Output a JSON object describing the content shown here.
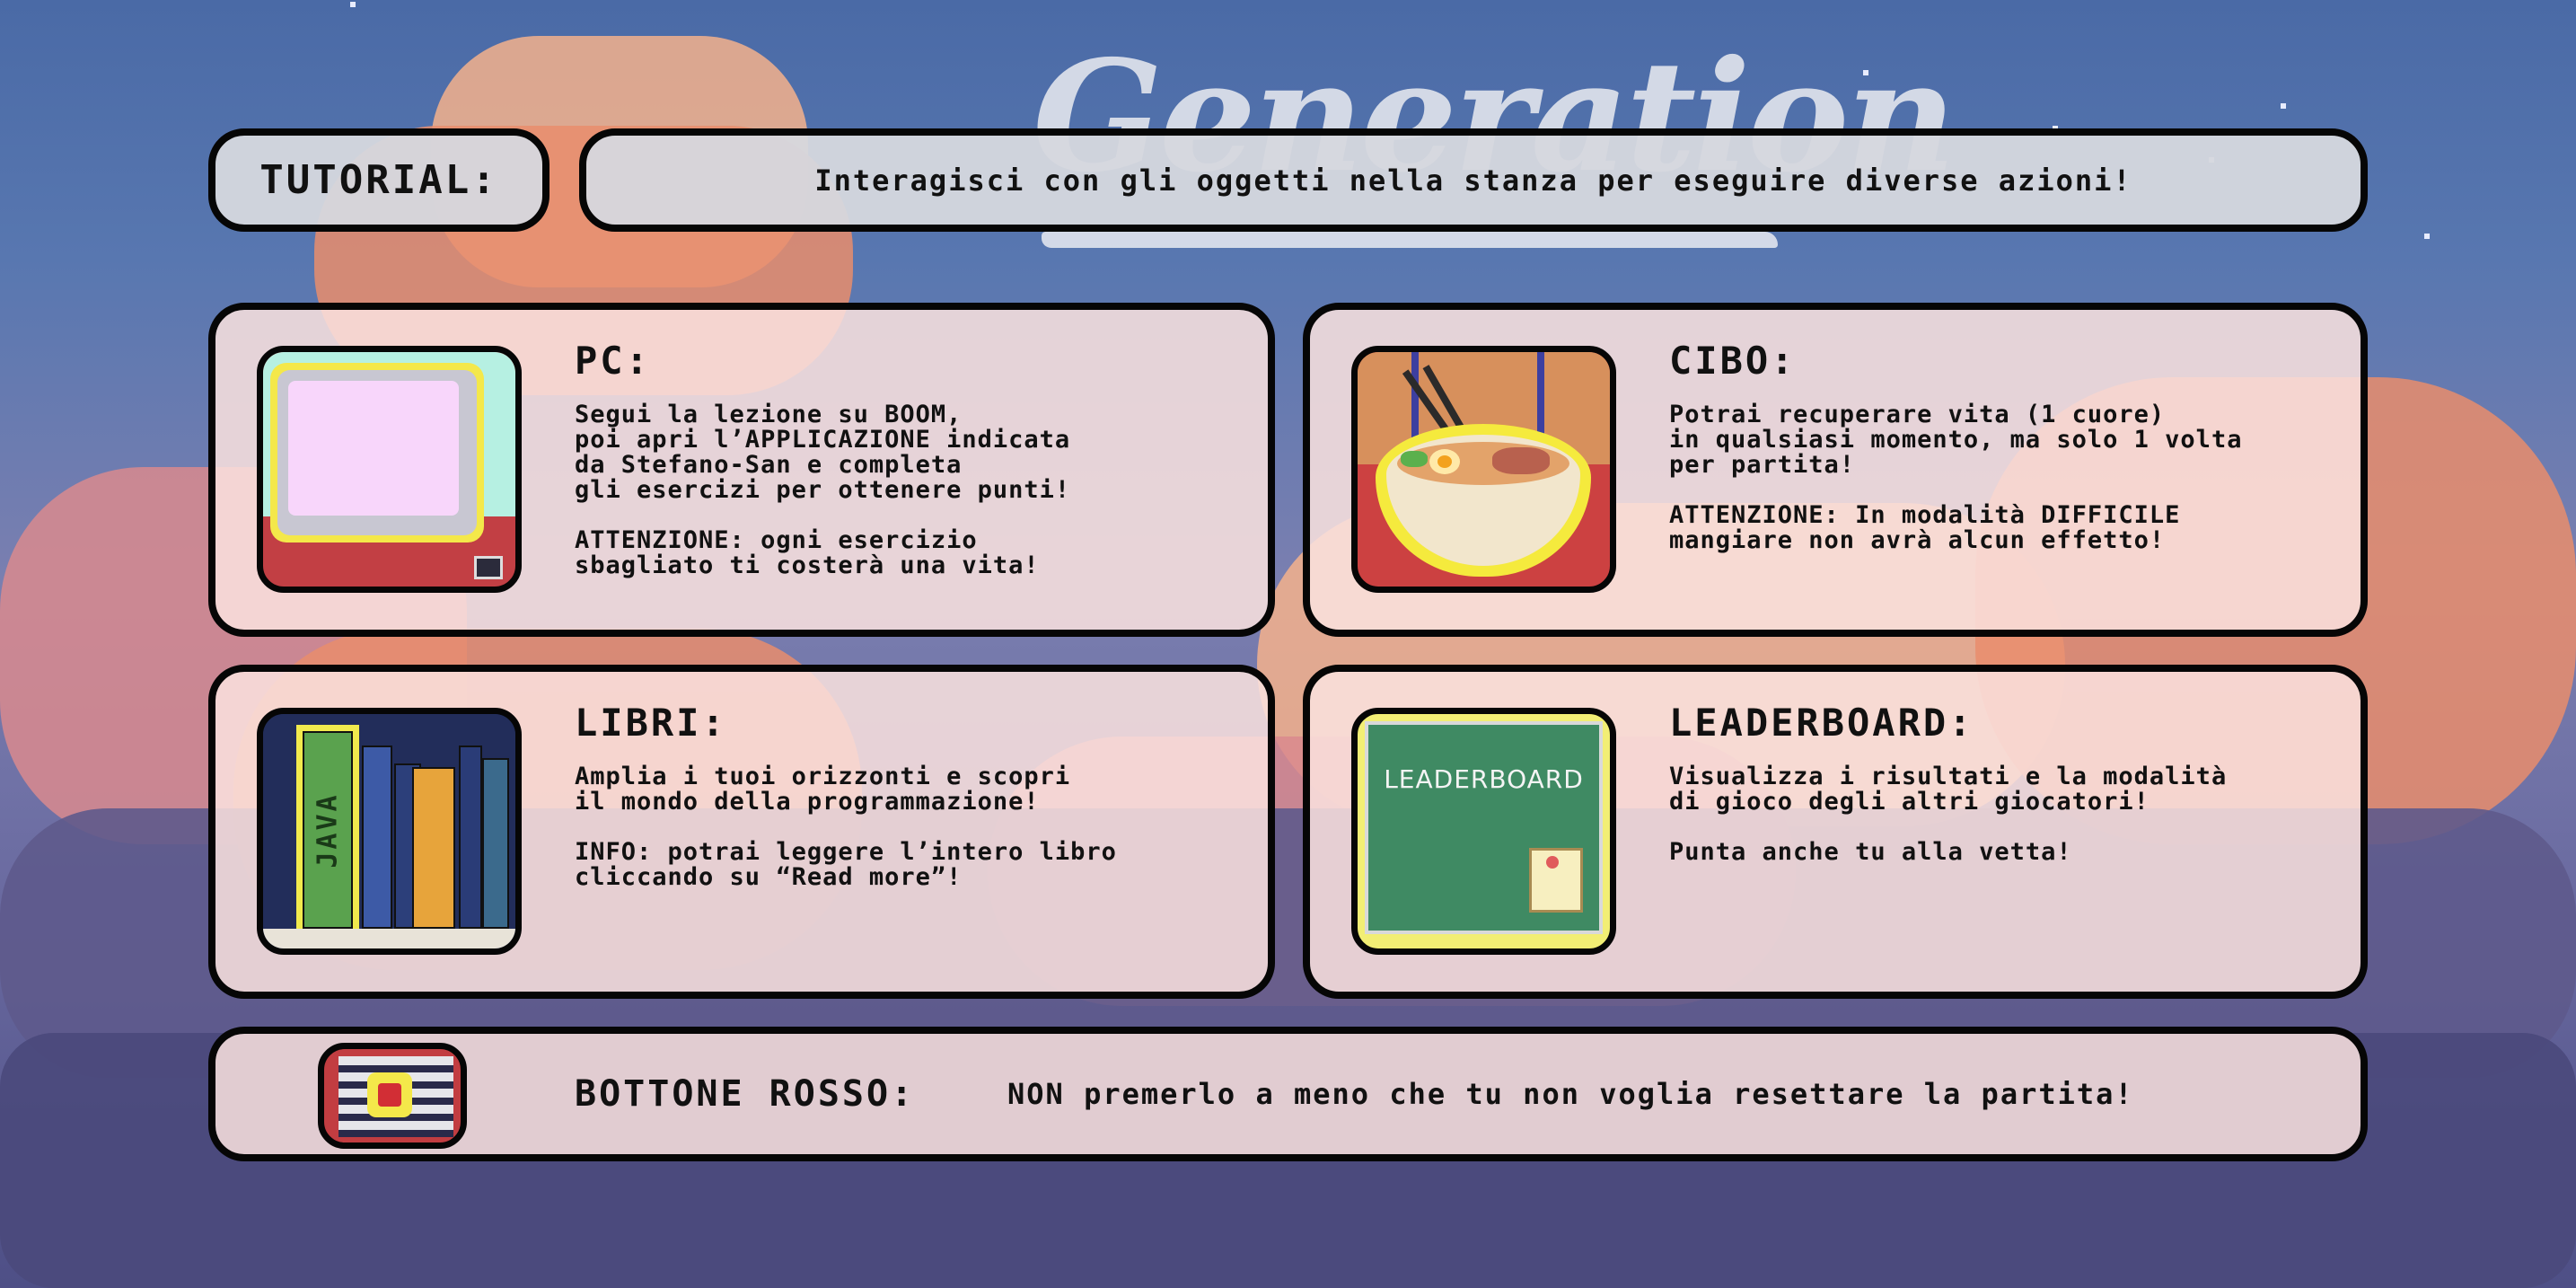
{
  "header": {
    "game_logo": "Generation"
  },
  "tutorial": {
    "label": "TUTORIAL:",
    "text": "Interagisci con gli oggetti nella stanza per eseguire diverse azioni!"
  },
  "cards": {
    "pc": {
      "title": "PC:",
      "lines": [
        "Segui la lezione su BOOM,",
        "poi apri l’APPLICAZIONE indicata",
        "da Stefano-San e completa",
        "gli esercizi per ottenere punti!",
        "ATTENZIONE: ogni esercizio",
        "sbagliato ti costerà una vita!"
      ]
    },
    "cibo": {
      "title": "CIBO:",
      "lines": [
        "Potrai recuperare vita (1 cuore)",
        "in qualsiasi momento, ma solo 1 volta",
        "per partita!",
        "ATTENZIONE: In modalità DIFFICILE",
        "mangiare non avrà alcun effetto!"
      ]
    },
    "libri": {
      "title": "LIBRI:",
      "lines": [
        "Amplia i tuoi orizzonti e scopri",
        "il mondo della programmazione!",
        "INFO: potrai leggere l’intero libro",
        "cliccando su “Read more”!"
      ],
      "book_label": "JAVA"
    },
    "leaderboard": {
      "title": "LEADERBOARD:",
      "lines": [
        "Visualizza i risultati e la modalità",
        "di gioco degli altri giocatori!",
        "Punta anche tu alla vetta!"
      ],
      "board_label": "LEADERBOARD"
    },
    "rosso": {
      "title": "BOTTONE ROSSO:",
      "text": "NON premerlo a meno che tu non voglia resettare la partita!"
    }
  },
  "icons": [
    "pc-monitor-icon",
    "ramen-bowl-icon",
    "java-book-icon",
    "leaderboard-icon",
    "red-button-icon"
  ],
  "colors": {
    "sky": "#4a6aa6",
    "panel": "#fae2de",
    "border": "#060606",
    "cloud": "#e98d6c"
  }
}
